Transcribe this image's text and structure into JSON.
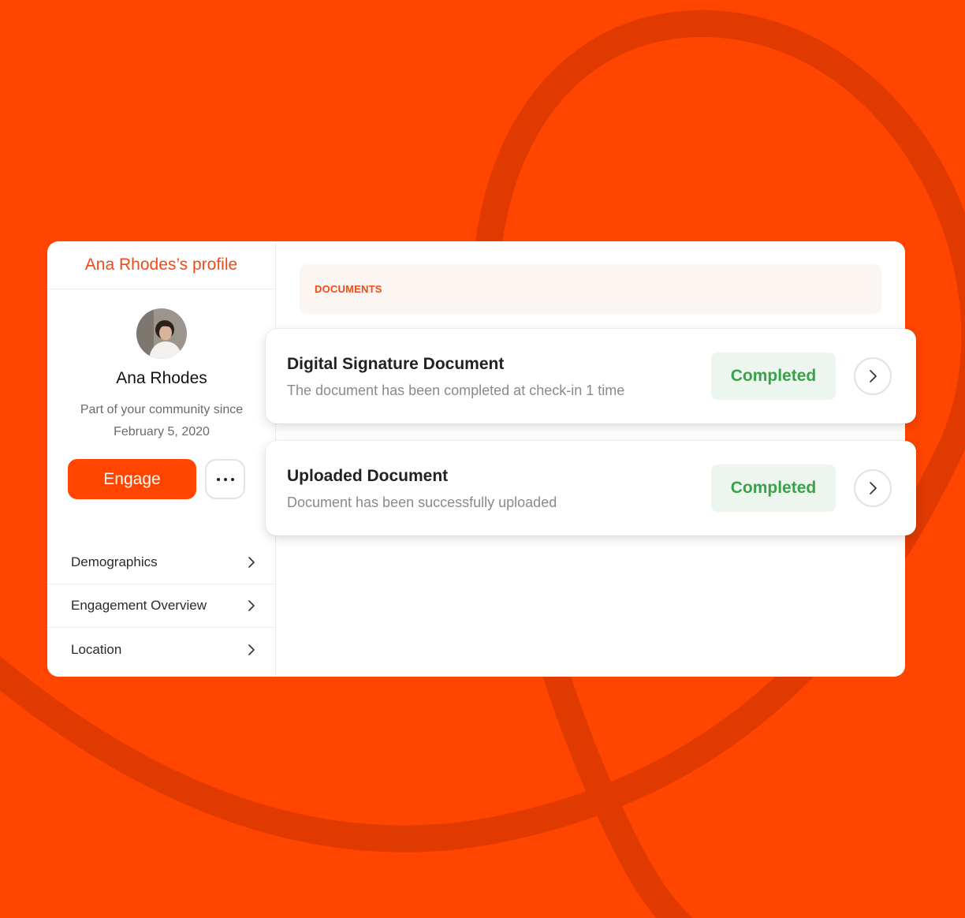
{
  "theme": {
    "background": "#FF4500",
    "accent": "#F04A18",
    "success": "#3AA14B",
    "success_bg": "#EDF6EE"
  },
  "sidebar": {
    "title": "Ana Rhodes’s profile",
    "name": "Ana Rhodes",
    "since_line1": "Part of your community since",
    "since_line2": "February 5, 2020",
    "engage_label": "Engage",
    "nav": [
      {
        "label": "Demographics"
      },
      {
        "label": "Engagement Overview"
      },
      {
        "label": "Location"
      }
    ]
  },
  "main": {
    "section_label": "DOCUMENTS",
    "documents": [
      {
        "title": "Digital Signature Document",
        "description": "The document has been completed at check-in 1 time",
        "status": "Completed"
      },
      {
        "title": "Uploaded Document",
        "description": "Document has been successfully uploaded",
        "status": "Completed"
      }
    ]
  }
}
